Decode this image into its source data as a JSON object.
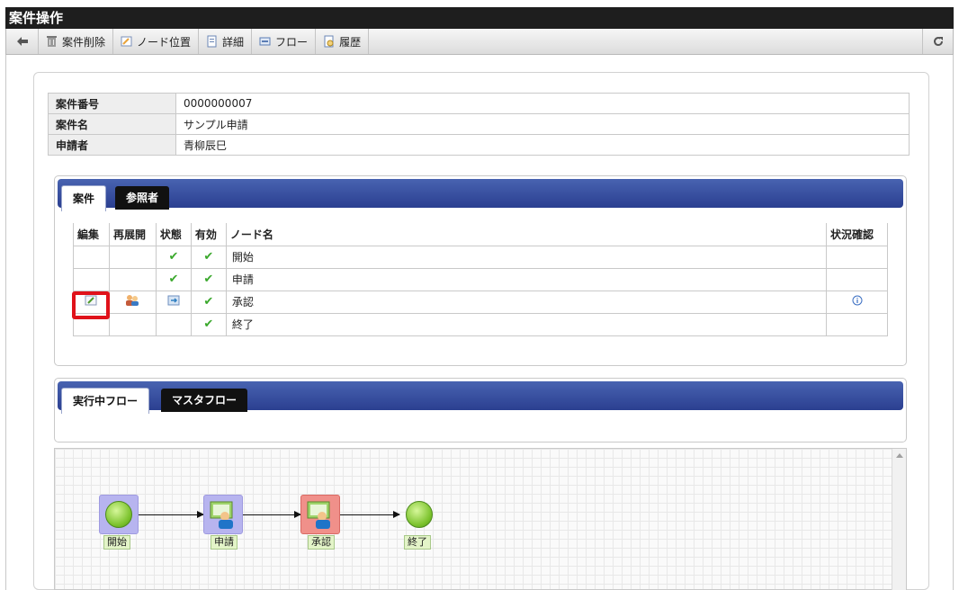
{
  "window": {
    "title": "案件操作"
  },
  "toolbar": {
    "delete_label": "案件削除",
    "node_position_label": "ノード位置",
    "detail_label": "詳細",
    "flow_label": "フロー",
    "history_label": "履歴"
  },
  "info": {
    "rows": [
      {
        "label": "案件番号",
        "value": "0000000007"
      },
      {
        "label": "案件名",
        "value": "サンプル申請"
      },
      {
        "label": "申請者",
        "value": "青柳辰巳"
      }
    ]
  },
  "case_panel": {
    "tabs": [
      {
        "label": "案件",
        "active": true
      },
      {
        "label": "参照者",
        "active": false
      }
    ],
    "columns": [
      "編集",
      "再展開",
      "状態",
      "有効",
      "ノード名",
      "状況確認"
    ],
    "rows": [
      {
        "node_name": "開始"
      },
      {
        "node_name": "申請"
      },
      {
        "node_name": "承認"
      },
      {
        "node_name": "終了"
      }
    ]
  },
  "flow_panel": {
    "tabs": [
      {
        "label": "実行中フロー",
        "active": true
      },
      {
        "label": "マスタフロー",
        "active": false
      }
    ],
    "nodes": [
      {
        "label": "開始",
        "type": "start"
      },
      {
        "label": "申請",
        "type": "user-task"
      },
      {
        "label": "承認",
        "type": "user-task-current"
      },
      {
        "label": "終了",
        "type": "end"
      }
    ]
  },
  "colors": {
    "header_blue": "#2b3f90",
    "highlight_red": "#e0121a",
    "check_green": "#3aa82c",
    "current_node": "#f0908a",
    "node_blue": "#b7b4ef"
  }
}
